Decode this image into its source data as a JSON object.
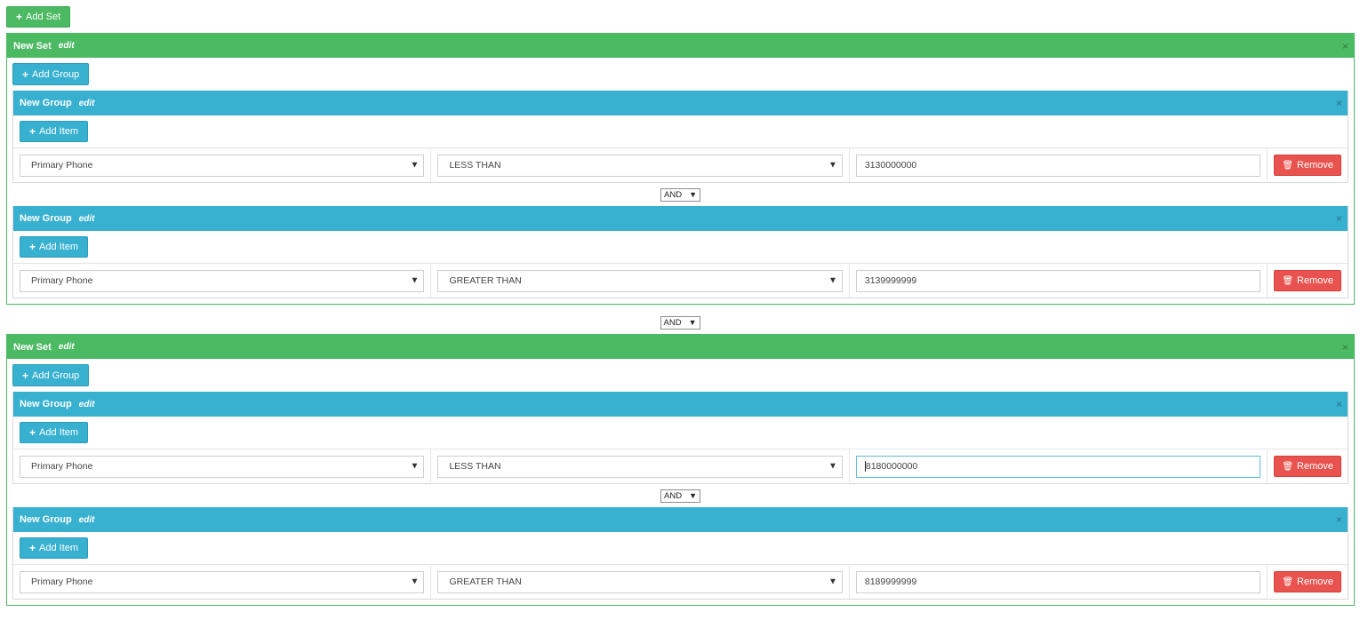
{
  "toolbar": {
    "add_set_label": "Add Set"
  },
  "sets": [
    {
      "title": "New Set",
      "edit_label": "edit",
      "close_glyph": "×",
      "add_group_label": "Add Group",
      "groups": [
        {
          "title": "New Group",
          "edit_label": "edit",
          "close_glyph": "×",
          "add_item_label": "Add Item",
          "item": {
            "field": "Primary Phone",
            "operator": "LESS THAN",
            "value": "3130000000",
            "remove_label": "Remove"
          }
        },
        {
          "title": "New Group",
          "edit_label": "edit",
          "close_glyph": "×",
          "add_item_label": "Add Item",
          "item": {
            "field": "Primary Phone",
            "operator": "GREATER THAN",
            "value": "3139999999",
            "remove_label": "Remove"
          }
        }
      ],
      "group_joiner": "AND"
    },
    {
      "title": "New Set",
      "edit_label": "edit",
      "close_glyph": "×",
      "add_group_label": "Add Group",
      "groups": [
        {
          "title": "New Group",
          "edit_label": "edit",
          "close_glyph": "×",
          "add_item_label": "Add Item",
          "item": {
            "field": "Primary Phone",
            "operator": "LESS THAN",
            "value": "8180000000",
            "remove_label": "Remove"
          }
        },
        {
          "title": "New Group",
          "edit_label": "edit",
          "close_glyph": "×",
          "add_item_label": "Add Item",
          "item": {
            "field": "Primary Phone",
            "operator": "GREATER THAN",
            "value": "8189999999",
            "remove_label": "Remove"
          }
        }
      ],
      "group_joiner": "AND"
    }
  ],
  "set_joiner": "AND",
  "colors": {
    "set_green": "#4cb963",
    "group_blue": "#38b0d0",
    "remove_red": "#e9534f"
  },
  "icons": {
    "plus": "plus-icon",
    "trash": "trash-icon",
    "caret": "caret-down-icon",
    "close": "close-icon"
  }
}
